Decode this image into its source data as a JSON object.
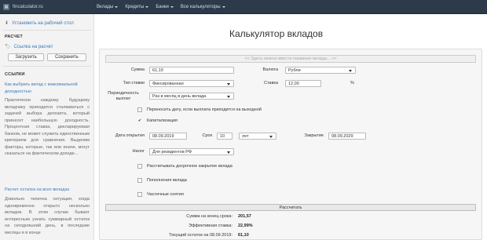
{
  "navbar": {
    "brand": "fincalculator.ru",
    "menu": [
      {
        "label": "Вклады"
      },
      {
        "label": "Кредиты"
      },
      {
        "label": "Банки"
      },
      {
        "label": "Все калькуляторы"
      }
    ]
  },
  "sidebar": {
    "install_link": "Установить на рабочий стол",
    "calc_heading": "РАСЧЕТ",
    "calc_link": "Ссылка на расчет",
    "load_button": "Загрузить",
    "save_button": "Сохранить",
    "links_heading": "ССЫЛКИ",
    "article1_title": "Как выбрать вклад с максимальной доходностью",
    "article1_text": "Практически каждому будущему вкладчику приходится сталкиваться с задачей выбора депозита, который принесет наибольшую доходность. Процентная ставка, декларируемая банком, не может служить единственным критерием для сравнения. Выделим факторы, которые, так или иначе, могут сказаться на фактическом доходе...",
    "article2_title": "Расчет остатка на всех вкладах",
    "article2_text": "Довольно типична ситуация, когда одновременно открыто несколько вкладов. В этом случае бывает интересным узнать суммарный остаток на сегодняшний день, в последние месяцы и в конце"
  },
  "main": {
    "title": "Калькулятор вкладов",
    "name_placeholder": "<< Здесь можно ввести название вклада... >>",
    "sum_label": "Сумма",
    "sum_value": "61,10",
    "currency_label": "Валюта",
    "currency_value": "Рубли",
    "rate_type_label": "Тип ставки",
    "rate_type_value": "Фиксированная",
    "rate_label": "Ставка",
    "rate_value": "12,00",
    "rate_unit": "%",
    "payout_label": "Периодичность выплат",
    "payout_value": "Раз в месяц в день вклада",
    "move_dates_label": "Переносить дату, если выплата приходится на выходной",
    "capitalization_label": "Капитализация",
    "open_date_label": "Дата открытия",
    "open_date_value": "08.09.2019",
    "term_label": "Срок",
    "term_value": "10",
    "term_unit_value": "лет",
    "close_label": "Закрытие",
    "close_value": "08.09.2029",
    "tax_label": "Налог",
    "tax_value": "Для резидентов РФ",
    "early_close_label": "Рассчитывать досрочное закрытие вклада",
    "refill_label": "Пополнения вклада",
    "withdraw_label": "Частичные снятия",
    "calc_button": "Рассчитать"
  },
  "results": {
    "end_sum_label": "Сумма на конец срока:",
    "end_sum_value": "201,57",
    "effective_rate_label": "Эффективная ставка:",
    "effective_rate_value": "22,99%",
    "current_balance_label": "Текущий остаток на 08.09.2019:",
    "current_balance_value": "61,10"
  }
}
